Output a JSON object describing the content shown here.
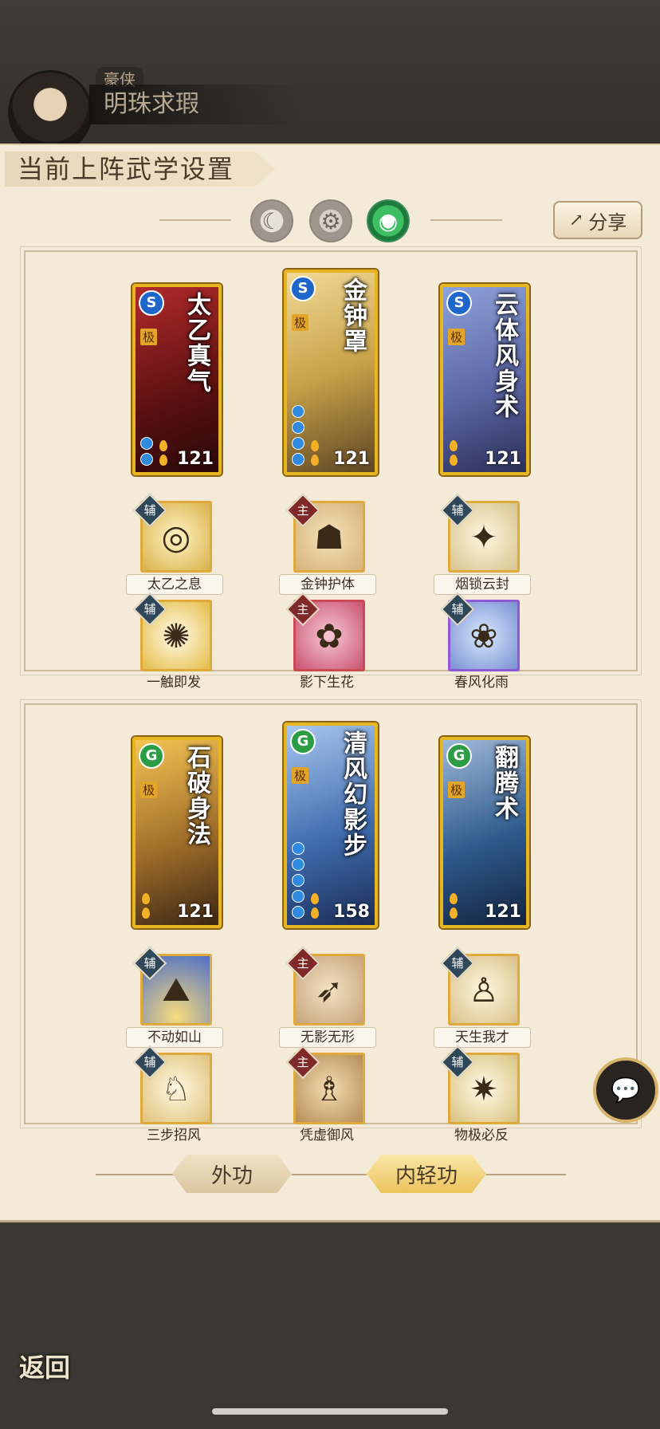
{
  "player": {
    "title_tag": "豪侠",
    "name": "明珠求瑕"
  },
  "panel": {
    "header": "当前上阵武学设置",
    "share_label": "分享"
  },
  "modes": [
    {
      "icon": "moon-icon",
      "active": false
    },
    {
      "icon": "gear-icon",
      "active": false
    },
    {
      "icon": "jade-icon",
      "active": true
    }
  ],
  "groups": [
    {
      "cards": [
        {
          "name": "太乙真气",
          "level": "121",
          "badge": "S",
          "tag": "极",
          "color": "#b12a2a"
        },
        {
          "name": "金钟罩",
          "level": "121",
          "badge": "S",
          "tag": "极",
          "color": "#c9a24a"
        },
        {
          "name": "云体风身术",
          "level": "121",
          "badge": "S",
          "tag": "极",
          "color": "#6a79b8"
        }
      ],
      "skills_row1": [
        {
          "label": "太乙之息",
          "role": "辅"
        },
        {
          "label": "金钟护体",
          "role": "主"
        },
        {
          "label": "烟锁云封",
          "role": "辅"
        }
      ],
      "skills_row2": [
        {
          "label": "一触即发",
          "role": "辅"
        },
        {
          "label": "影下生花",
          "role": "主"
        },
        {
          "label": "春风化雨",
          "role": "辅"
        }
      ]
    },
    {
      "cards": [
        {
          "name": "石破身法",
          "level": "121",
          "badge": "G",
          "tag": "极",
          "color": "#a06d2a"
        },
        {
          "name": "清风幻影步",
          "level": "158",
          "badge": "G",
          "tag": "极",
          "color": "#3f6cae"
        },
        {
          "name": "翻腾术",
          "level": "121",
          "badge": "G",
          "tag": "极",
          "color": "#2e5a8c"
        }
      ],
      "skills_row1": [
        {
          "label": "不动如山",
          "role": "辅"
        },
        {
          "label": "无影无形",
          "role": "主"
        },
        {
          "label": "天生我才",
          "role": "辅"
        }
      ],
      "skills_row2": [
        {
          "label": "三步招风",
          "role": "辅"
        },
        {
          "label": "凭虚御风",
          "role": "主"
        },
        {
          "label": "物极必反",
          "role": "辅"
        }
      ]
    }
  ],
  "bottom_tabs": {
    "outer": "外功",
    "inner": "内轻功"
  },
  "back_label": "返回"
}
